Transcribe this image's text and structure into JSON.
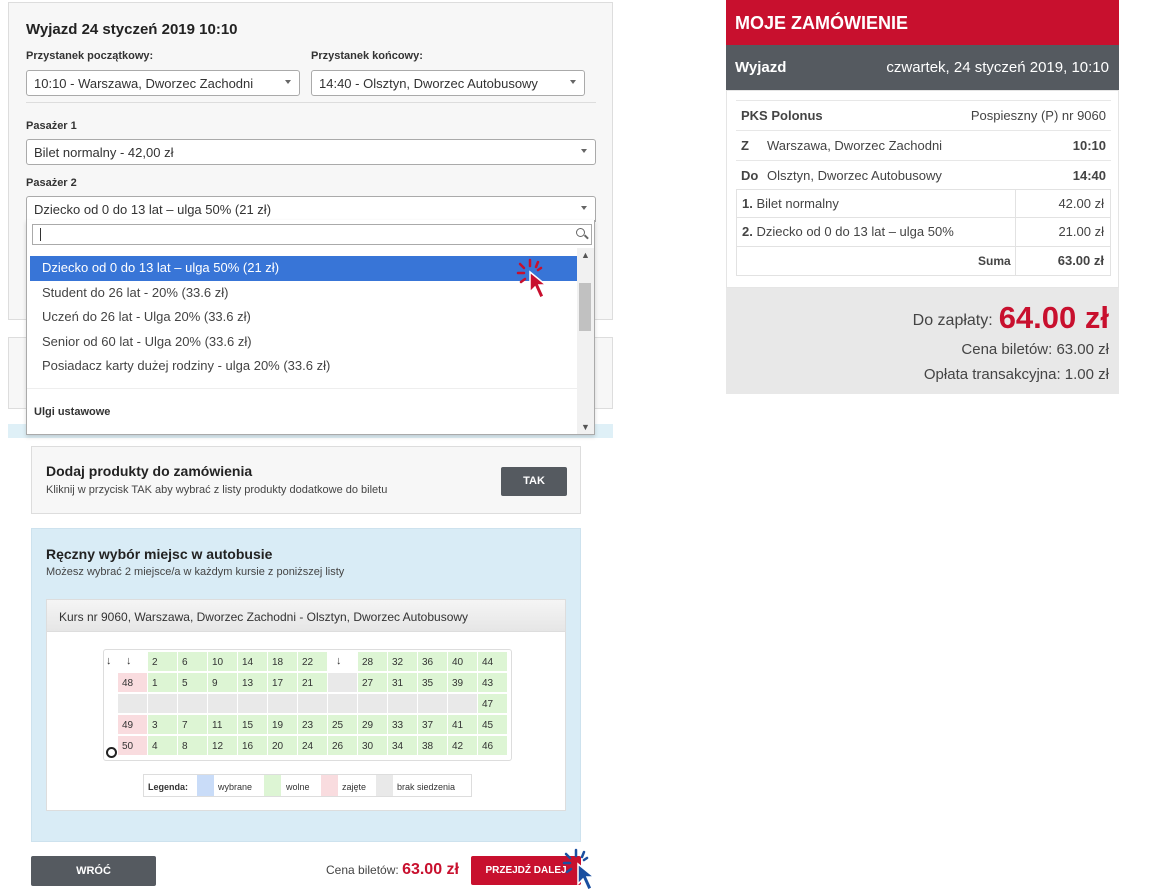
{
  "trip": {
    "title": "Wyjazd 24 styczeń 2019 10:10",
    "start_label": "Przystanek początkowy:",
    "start_value": "10:10 - Warszawa, Dworzec Zachodni",
    "end_label": "Przystanek końcowy:",
    "end_value": "14:40 - Olsztyn, Dworzec Autobusowy",
    "p1_label": "Pasażer 1",
    "p1_value": "Bilet normalny - 42,00 zł",
    "p2_label": "Pasażer 2",
    "p2_value": "Dziecko od 0 do 13 lat – ulga 50% (21 zł)"
  },
  "dropdown": {
    "search_value": "",
    "options": [
      "Dziecko od 0 do 13 lat – ulga 50% (21 zł)",
      "Student do 26 lat - 20% (33.6 zł)",
      "Uczeń do 26 lat - Ulga 20% (33.6 zł)",
      "Senior od 60 lat - Ulga 20% (33.6 zł)",
      "Posiadacz karty dużej rodziny - ulga 20% (33.6 zł)"
    ],
    "selected_index": 0,
    "group_label": "Ulgi ustawowe"
  },
  "products": {
    "title": "Dodaj produkty do zamówienia",
    "subtitle": "Kliknij w przycisk TAK aby wybrać z listy produkty dodatkowe do biletu",
    "button": "TAK"
  },
  "seats": {
    "title": "Ręczny wybór miejsc w autobusie",
    "subtitle": "Możesz wybrać 2 miejsce/a w każdym kursie z poniższej listy",
    "course": "Kurs nr 9060, Warszawa, Dworzec Zachodni - Olsztyn, Dworzec Autobusowy",
    "rows": [
      [
        [
          "door",
          "↓"
        ],
        [
          "door",
          "↓"
        ],
        [
          "free",
          "2"
        ],
        [
          "free",
          "6"
        ],
        [
          "free",
          "10"
        ],
        [
          "free",
          "14"
        ],
        [
          "free",
          "18"
        ],
        [
          "free",
          "22"
        ],
        [
          "door",
          "↓"
        ],
        [
          "free",
          "28"
        ],
        [
          "free",
          "32"
        ],
        [
          "free",
          "36"
        ],
        [
          "free",
          "40"
        ],
        [
          "free",
          "44"
        ]
      ],
      [
        [
          "blank",
          ""
        ],
        [
          "taken",
          "48"
        ],
        [
          "free",
          "1"
        ],
        [
          "free",
          "5"
        ],
        [
          "free",
          "9"
        ],
        [
          "free",
          "13"
        ],
        [
          "free",
          "17"
        ],
        [
          "free",
          "21"
        ],
        [
          "none",
          ""
        ],
        [
          "free",
          "27"
        ],
        [
          "free",
          "31"
        ],
        [
          "free",
          "35"
        ],
        [
          "free",
          "39"
        ],
        [
          "free",
          "43"
        ]
      ],
      [
        [
          "blank",
          ""
        ],
        [
          "none",
          ""
        ],
        [
          "none",
          ""
        ],
        [
          "none",
          ""
        ],
        [
          "none",
          ""
        ],
        [
          "none",
          ""
        ],
        [
          "none",
          ""
        ],
        [
          "none",
          ""
        ],
        [
          "none",
          ""
        ],
        [
          "none",
          ""
        ],
        [
          "none",
          ""
        ],
        [
          "none",
          ""
        ],
        [
          "none",
          ""
        ],
        [
          "free",
          "47"
        ]
      ],
      [
        [
          "blank",
          ""
        ],
        [
          "taken",
          "49"
        ],
        [
          "free",
          "3"
        ],
        [
          "free",
          "7"
        ],
        [
          "free",
          "11"
        ],
        [
          "free",
          "15"
        ],
        [
          "free",
          "19"
        ],
        [
          "free",
          "23"
        ],
        [
          "free",
          "25"
        ],
        [
          "free",
          "29"
        ],
        [
          "free",
          "33"
        ],
        [
          "free",
          "37"
        ],
        [
          "free",
          "41"
        ],
        [
          "free",
          "45"
        ]
      ],
      [
        [
          "blank",
          ""
        ],
        [
          "taken",
          "50"
        ],
        [
          "free",
          "4"
        ],
        [
          "free",
          "8"
        ],
        [
          "free",
          "12"
        ],
        [
          "free",
          "16"
        ],
        [
          "free",
          "20"
        ],
        [
          "free",
          "24"
        ],
        [
          "free",
          "26"
        ],
        [
          "free",
          "30"
        ],
        [
          "free",
          "34"
        ],
        [
          "free",
          "38"
        ],
        [
          "free",
          "42"
        ],
        [
          "free",
          "46"
        ]
      ]
    ],
    "legend": {
      "label": "Legenda:",
      "selected": "wybrane",
      "free": "wolne",
      "taken": "zajęte",
      "none": "brak siedzenia"
    },
    "colors": {
      "selected": "#c9dcf8",
      "free": "#ddf5d4",
      "taken": "#f9dcdf",
      "none": "#e9e9e9"
    }
  },
  "footer": {
    "back": "WRÓĆ",
    "price_label": "Cena biletów:",
    "price_value": "63.00 zł",
    "next": "PRZEJDŹ DALEJ"
  },
  "order": {
    "header": "MOJE ZAMÓWIENIE",
    "dep_label": "Wyjazd",
    "dep_value": "czwartek, 24 styczeń 2019, 10:10",
    "carrier": "PKS Polonus",
    "service": "Pospieszny (P) nr 9060",
    "from_label": "Z",
    "from": "Warszawa, Dworzec Zachodni",
    "from_time": "10:10",
    "to_label": "Do",
    "to": "Olsztyn, Dworzec Autobusowy",
    "to_time": "14:40",
    "tickets": [
      {
        "num": "1.",
        "name": "Bilet normalny",
        "price": "42.00 zł"
      },
      {
        "num": "2.",
        "name": "Dziecko od 0 do 13 lat – ulga 50%",
        "price": "21.00 zł"
      }
    ],
    "sum_label": "Suma",
    "sum_value": "63.00 zł",
    "topay_label": "Do zapłaty:",
    "topay_value": "64.00 zł",
    "tickets_price": "Cena biletów: 63.00 zł",
    "fee": "Opłata transakcyjna: 1.00 zł",
    "accent": "#c8102e"
  }
}
